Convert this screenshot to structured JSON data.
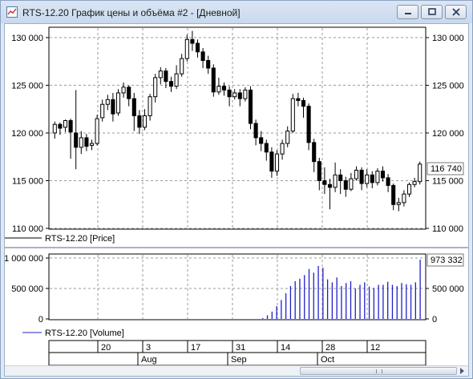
{
  "window": {
    "title": "RTS-12.20 График цены и объёма #2 - [Дневной]",
    "icon": "chart-app-icon"
  },
  "price_panel": {
    "y_ticks": [
      "130 000",
      "125 000",
      "120 000",
      "115 000",
      "110 000"
    ],
    "last_value": "116 740",
    "legend": "RTS-12.20 [Price]"
  },
  "volume_panel": {
    "left_ticks": [
      "1 000 000",
      "500 000",
      "0"
    ],
    "right_ticks": [
      "500 000",
      "0"
    ],
    "last_value": "973 332",
    "legend": "RTS-12.20 [Volume]"
  },
  "time_axis": {
    "days": [
      "20",
      "3",
      "17",
      "31",
      "14",
      "28",
      "12"
    ],
    "months": [
      "Aug",
      "Sep",
      "Oct"
    ]
  },
  "colors": {
    "up": "#ffffff",
    "down": "#000000",
    "volume": "#2020c8",
    "last_value_text": "#2020c8",
    "grid": "#9a9a9a"
  },
  "chart_data": [
    {
      "type": "candlestick",
      "title": "",
      "ylim": [
        110000,
        131000
      ],
      "ylabel": "",
      "legend": "RTS-12.20 [Price]",
      "last_value": 116740,
      "candles": [
        [
          120000,
          120900,
          119400,
          121200
        ],
        [
          120900,
          120500,
          119800,
          121100
        ],
        [
          120600,
          121300,
          120100,
          121400
        ],
        [
          121300,
          120100,
          117300,
          121500
        ],
        [
          120000,
          118500,
          116200,
          124500
        ],
        [
          118500,
          119500,
          117800,
          120200
        ],
        [
          119500,
          118600,
          118100,
          119900
        ],
        [
          118700,
          118900,
          118200,
          119300
        ],
        [
          118900,
          121500,
          118700,
          121900
        ],
        [
          121600,
          123000,
          121200,
          123500
        ],
        [
          123000,
          123500,
          122400,
          124000
        ],
        [
          123500,
          122000,
          121200,
          124200
        ],
        [
          122100,
          124200,
          121800,
          124600
        ],
        [
          124200,
          124800,
          123700,
          125300
        ],
        [
          124800,
          123600,
          122800,
          125000
        ],
        [
          123600,
          121800,
          120200,
          124200
        ],
        [
          121800,
          120600,
          119900,
          122400
        ],
        [
          120600,
          121800,
          120300,
          122500
        ],
        [
          121800,
          123800,
          121300,
          124100
        ],
        [
          123800,
          125800,
          123200,
          126200
        ],
        [
          125800,
          126500,
          125100,
          126900
        ],
        [
          126500,
          125400,
          124700,
          126800
        ],
        [
          125400,
          124900,
          124300,
          125900
        ],
        [
          124900,
          126200,
          124600,
          127100
        ],
        [
          126200,
          127800,
          125900,
          128300
        ],
        [
          127800,
          129800,
          127500,
          130300
        ],
        [
          129800,
          129400,
          128600,
          130700
        ],
        [
          129400,
          128500,
          127900,
          129800
        ],
        [
          128500,
          127600,
          126800,
          128900
        ],
        [
          127600,
          126800,
          126200,
          128100
        ],
        [
          126800,
          124300,
          123800,
          127200
        ],
        [
          124300,
          124900,
          124000,
          125800
        ],
        [
          124900,
          124500,
          123900,
          125300
        ],
        [
          124500,
          123800,
          122800,
          124900
        ],
        [
          123800,
          124200,
          123500,
          124600
        ],
        [
          124200,
          123600,
          122800,
          124600
        ],
        [
          123600,
          124500,
          123300,
          124800
        ],
        [
          124500,
          121000,
          120400,
          124900
        ],
        [
          121000,
          119500,
          118700,
          121400
        ],
        [
          119500,
          118900,
          118100,
          120200
        ],
        [
          118900,
          118000,
          117100,
          119300
        ],
        [
          118000,
          116000,
          115300,
          118500
        ],
        [
          116000,
          117800,
          115500,
          118200
        ],
        [
          117800,
          118900,
          117200,
          119300
        ],
        [
          118900,
          120200,
          118500,
          120700
        ],
        [
          120200,
          123600,
          120000,
          124100
        ],
        [
          123600,
          123400,
          122800,
          124200
        ],
        [
          123400,
          122800,
          121600,
          123700
        ],
        [
          122800,
          119000,
          118200,
          123100
        ],
        [
          119000,
          117000,
          115900,
          119400
        ],
        [
          117000,
          115000,
          114000,
          117400
        ],
        [
          115000,
          114600,
          113600,
          116400
        ],
        [
          114600,
          114300,
          112000,
          115200
        ],
        [
          114300,
          115600,
          113800,
          116900
        ],
        [
          115600,
          115000,
          113600,
          116200
        ],
        [
          115000,
          114100,
          113300,
          115400
        ],
        [
          114100,
          115200,
          113900,
          115800
        ],
        [
          115200,
          116100,
          115000,
          116500
        ],
        [
          116100,
          114700,
          114000,
          116400
        ],
        [
          114700,
          115600,
          114300,
          116200
        ],
        [
          115600,
          114800,
          114200,
          116000
        ],
        [
          114800,
          116000,
          114500,
          116300
        ],
        [
          116000,
          115300,
          114900,
          116500
        ],
        [
          115300,
          114500,
          113800,
          115700
        ],
        [
          114500,
          112500,
          111900,
          114700
        ],
        [
          112500,
          112700,
          111800,
          113200
        ],
        [
          112700,
          113600,
          112300,
          114000
        ],
        [
          113600,
          114600,
          113300,
          114800
        ],
        [
          114600,
          114900,
          114300,
          115300
        ],
        [
          114900,
          116740,
          114600,
          117000
        ]
      ]
    },
    {
      "type": "bar",
      "title": "",
      "ylim": [
        0,
        1000000
      ],
      "legend": "RTS-12.20 [Volume]",
      "last_value": 973332,
      "values": [
        0,
        0,
        0,
        0,
        0,
        0,
        0,
        0,
        0,
        0,
        0,
        0,
        0,
        0,
        0,
        0,
        0,
        0,
        0,
        0,
        0,
        0,
        0,
        0,
        0,
        0,
        0,
        0,
        0,
        0,
        0,
        0,
        0,
        0,
        0,
        0,
        0,
        0,
        0,
        0,
        0,
        0,
        0,
        0,
        0,
        15000,
        60000,
        120000,
        210000,
        310000,
        420000,
        540000,
        620000,
        660000,
        720000,
        820000,
        760000,
        870000,
        840000,
        650000,
        600000,
        680000,
        540000,
        590000,
        620000,
        500000,
        560000,
        600000,
        530000,
        510000,
        560000,
        560000,
        610000,
        560000,
        540000,
        590000,
        570000,
        560000,
        600000,
        973332
      ]
    }
  ]
}
